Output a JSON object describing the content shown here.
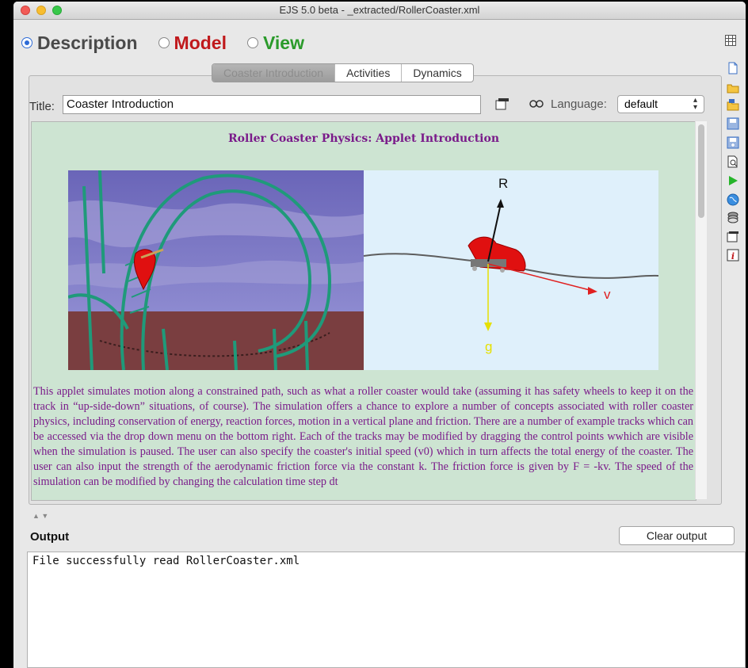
{
  "window": {
    "title": "EJS 5.0 beta - _extracted/RollerCoaster.xml"
  },
  "modes": [
    {
      "label": "Description",
      "color": "#4a4a4a",
      "selected": true
    },
    {
      "label": "Model",
      "color": "#c0191c",
      "selected": false
    },
    {
      "label": "View",
      "color": "#2a9a2a",
      "selected": false
    }
  ],
  "tabs": [
    "Coaster Introduction",
    "Activities",
    "Dynamics"
  ],
  "editor": {
    "title_label": "Title:",
    "title_value": "Coaster Introduction",
    "language_label": "Language:",
    "language_value": "default"
  },
  "page": {
    "heading": "Roller Coaster Physics: Applet Introduction",
    "figure_labels": {
      "r": "R",
      "v": "v",
      "g": "g"
    },
    "paragraph": "This applet simulates motion along a constrained path, such as what a roller coaster would take (assuming it has safety wheels to keep it on the track in “up-side-down” situations, of course). The simulation offers a chance to explore a number of concepts associated with roller coaster physics, including conservation of energy, reaction forces, motion in a vertical plane and friction. There are a number of example tracks which can be accessed via the drop down menu on the bottom right. Each of the tracks may be modified by dragging the control points wwhich are visible when the simulation is paused. The user can also specify the coaster's initial speed (v0) which in turn affects the total energy of the coaster. The user can also input the strength of the aerodynamic friction force via the constant k. The friction force is given by F = -kv. The speed of the simulation can be modified by changing the calculation time step dt"
  },
  "output": {
    "label": "Output",
    "clear_button": "Clear output",
    "text": "File successfully read RollerCoaster.xml"
  },
  "colors": {
    "content_bg": "#cde4d2",
    "heading": "#7a1a8a",
    "accent": "#2d6bd6"
  }
}
